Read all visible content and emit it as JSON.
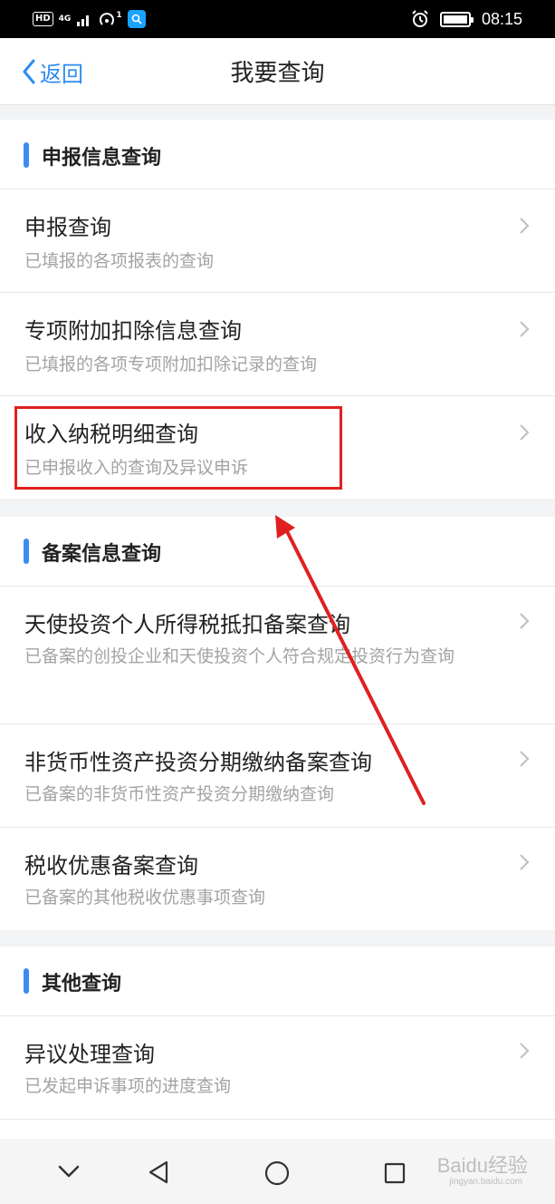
{
  "status_bar": {
    "hd": "HD",
    "network": "4G",
    "hotspot_count": "1",
    "time": "08:15",
    "icons": [
      "signal-icon",
      "hotspot-icon",
      "search-app-icon",
      "alarm-icon",
      "battery-icon"
    ]
  },
  "nav": {
    "back_label": "返回",
    "title": "我要查询"
  },
  "sections": [
    {
      "title": "申报信息查询",
      "items": [
        {
          "title": "申报查询",
          "subtitle": "已填报的各项报表的查询"
        },
        {
          "title": "专项附加扣除信息查询",
          "subtitle": "已填报的各项专项附加扣除记录的查询"
        },
        {
          "title": "收入纳税明细查询",
          "subtitle": "已申报收入的查询及异议申诉"
        }
      ]
    },
    {
      "title": "备案信息查询",
      "items": [
        {
          "title": "天使投资个人所得税抵扣备案查询",
          "subtitle": "已备案的创投企业和天使投资个人符合规定投资行为查询"
        },
        {
          "title": "非货币性资产投资分期缴纳备案查询",
          "subtitle": "已备案的非货币性资产投资分期缴纳查询"
        },
        {
          "title": "税收优惠备案查询",
          "subtitle": "已备案的其他税收优惠事项查询"
        }
      ]
    },
    {
      "title": "其他查询",
      "items": [
        {
          "title": "异议处理查询",
          "subtitle": "已发起申诉事项的进度查询"
        }
      ]
    }
  ],
  "watermark": {
    "brand": "Baidu经验",
    "url": "jingyan.baidu.com"
  },
  "colors": {
    "accent": "#2d8cf0",
    "section_bar": "#3d8bf2",
    "annotation": "#e02020",
    "subtitle": "#a3a3a3"
  }
}
